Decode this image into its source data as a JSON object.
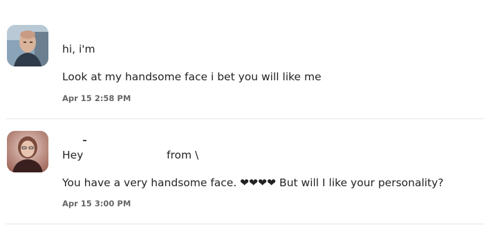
{
  "messages": [
    {
      "avatar_icon": "man-avatar",
      "greeting": "hi, i'm",
      "body": "Look at my handsome face i bet you will like me",
      "time": "Apr 15 2:58 PM"
    },
    {
      "avatar_icon": "woman-avatar",
      "greeting_hey": "Hey",
      "greeting_from": "from \\",
      "body": "You have a very handsome face. ❤❤❤❤ But will I like your personality?",
      "time": "Apr 15 3:00 PM"
    }
  ],
  "colors": {
    "divider": "#e6e6e6",
    "timestamp": "#666666",
    "text": "#222222"
  }
}
